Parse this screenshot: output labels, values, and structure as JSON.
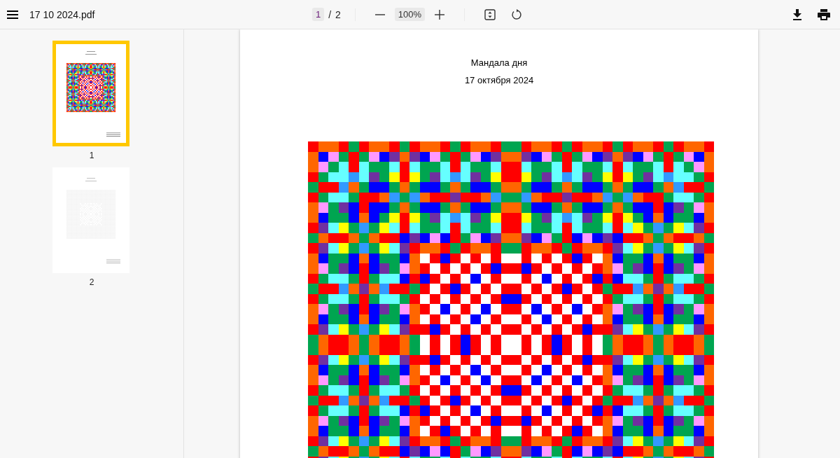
{
  "toolbar": {
    "file_name": "17 10 2024.pdf",
    "current_page": "1",
    "page_separator": "/",
    "page_count": "2",
    "zoom": "100%"
  },
  "thumbnails": [
    {
      "label": "1",
      "selected": true,
      "loaded": true
    },
    {
      "label": "2",
      "selected": false,
      "loaded": false
    }
  ],
  "page": {
    "title": "Мандала дня",
    "date": "17 октября 2024"
  }
}
